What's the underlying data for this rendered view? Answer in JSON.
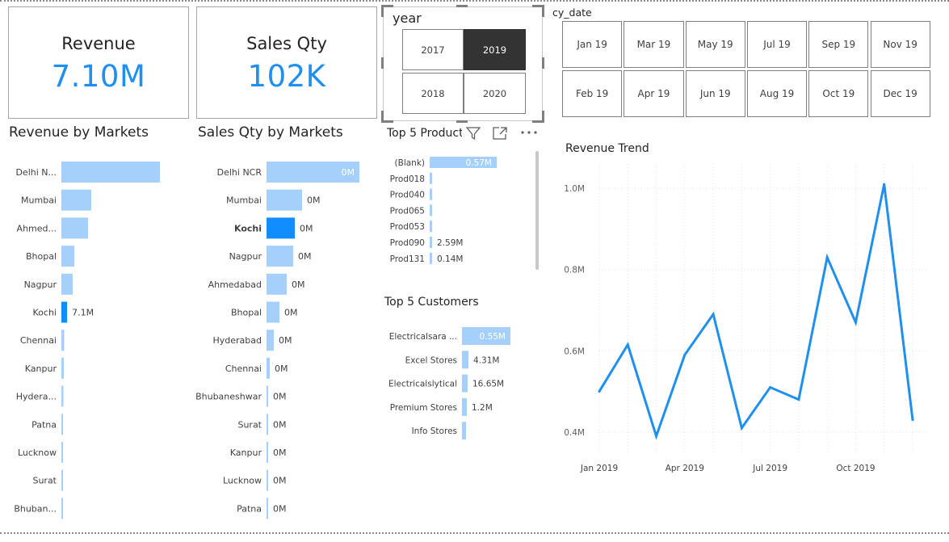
{
  "cards": {
    "revenue": {
      "title": "Revenue",
      "value": "7.10M"
    },
    "sales_qty": {
      "title": "Sales Qty",
      "value": "102K"
    }
  },
  "year_slicer": {
    "title": "year",
    "options": [
      "2017",
      "2019",
      "2018",
      "2020"
    ],
    "selected": "2019"
  },
  "month_slicer": {
    "title": "cy_date",
    "options": [
      "Jan 19",
      "Mar 19",
      "May 19",
      "Jul 19",
      "Sep 19",
      "Nov 19",
      "Feb 19",
      "Apr 19",
      "Jun 19",
      "Aug 19",
      "Oct 19",
      "Dec 19"
    ]
  },
  "colors": {
    "bar": "#a5d0fb",
    "bar_highlight": "#118dff",
    "line": "#1f8ff0",
    "card_value": "#1f8ff0"
  },
  "icons": [
    "filter-icon",
    "focus-mode-icon",
    "more-options-icon"
  ],
  "chart_data": [
    {
      "type": "bar",
      "orientation": "horizontal",
      "title": "Revenue by Markets",
      "categories": [
        "Delhi N...",
        "Mumbai",
        "Ahmed...",
        "Bhopal",
        "Nagpur",
        "Kochi",
        "Chennai",
        "Kanpur",
        "Hydera...",
        "Patna",
        "Lucknow",
        "Surat",
        "Bhuban..."
      ],
      "values": [
        122,
        37,
        33,
        16,
        14,
        7.1,
        3.5,
        3,
        2.5,
        1.5,
        1.2,
        1,
        0.8
      ],
      "data_labels": [
        "",
        "",
        "",
        "",
        "",
        "7.1M",
        "",
        "",
        "",
        "",
        "",
        "",
        ""
      ],
      "highlighted": "Kochi",
      "units": "M (relative)"
    },
    {
      "type": "bar",
      "orientation": "horizontal",
      "title": "Sales Qty by Markets",
      "categories": [
        "Delhi NCR",
        "Mumbai",
        "Kochi",
        "Nagpur",
        "Ahmedabad",
        "Bhopal",
        "Hyderabad",
        "Chennai",
        "Bhubaneshwar",
        "Surat",
        "Kanpur",
        "Lucknow",
        "Patna"
      ],
      "values": [
        115,
        44,
        35,
        33,
        25,
        16,
        9,
        4,
        2,
        2,
        1.5,
        1.2,
        1
      ],
      "data_labels": [
        "0M",
        "0M",
        "0M",
        "0M",
        "0M",
        "0M",
        "0M",
        "0M",
        "0M",
        "0M",
        "0M",
        "0M",
        "0M"
      ],
      "highlighted": "Kochi"
    },
    {
      "type": "bar",
      "orientation": "horizontal",
      "title": "Top 5 Product",
      "categories": [
        "(Blank)",
        "Prod018",
        "Prod040",
        "Prod065",
        "Prod053",
        "Prod090",
        "Prod131"
      ],
      "values": [
        83,
        3,
        3,
        3,
        3,
        2,
        2
      ],
      "data_labels": [
        "0.57M",
        "",
        "",
        "",
        "",
        "2.59M",
        "0.14M"
      ]
    },
    {
      "type": "bar",
      "orientation": "horizontal",
      "title": "Top 5 Customers",
      "categories": [
        "Electricalsara ...",
        "Excel Stores",
        "Electricalslytical",
        "Premium Stores",
        "Info Stores"
      ],
      "values": [
        60,
        8,
        7,
        6,
        5
      ],
      "data_labels": [
        "0.55M",
        "4.31M",
        "16.65M",
        "1.2M",
        ""
      ]
    },
    {
      "type": "line",
      "title": "Revenue Trend",
      "x": [
        "Jan 2019",
        "Feb 2019",
        "Mar 2019",
        "Apr 2019",
        "May 2019",
        "Jun 2019",
        "Jul 2019",
        "Aug 2019",
        "Sep 2019",
        "Oct 2019",
        "Nov 2019",
        "Dec 2019"
      ],
      "y": [
        0.5,
        0.615,
        0.39,
        0.59,
        0.69,
        0.41,
        0.51,
        0.48,
        0.83,
        0.67,
        1.01,
        0.43
      ],
      "y_ticks": [
        "0.4M",
        "0.6M",
        "0.8M",
        "1.0M"
      ],
      "x_ticks": [
        "Jan 2019",
        "Apr 2019",
        "Jul 2019",
        "Oct 2019"
      ],
      "ylim": [
        0.35,
        1.06
      ],
      "grid": true
    }
  ]
}
